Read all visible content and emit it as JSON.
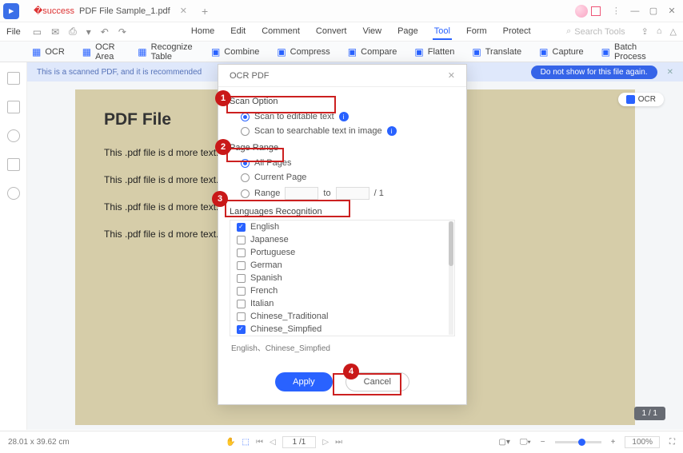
{
  "titlebar": {
    "tab_title": "PDF File Sample_1.pdf"
  },
  "menurow": {
    "file": "File",
    "items": [
      "Home",
      "Edit",
      "Comment",
      "Convert",
      "View",
      "Page",
      "Tool",
      "Form",
      "Protect"
    ],
    "active": "Tool",
    "search_placeholder": "Search Tools"
  },
  "toolbar": {
    "items": [
      "OCR",
      "OCR Area",
      "Recognize Table",
      "Combine",
      "Compress",
      "Compare",
      "Flatten",
      "Translate",
      "Capture",
      "Batch Process"
    ]
  },
  "banner": {
    "text": "This is a scanned PDF, and it is recommended",
    "pill": "Do not show for this file again."
  },
  "ocr_badge": "OCR",
  "document": {
    "heading": "PDF File",
    "p1": "This .pdf file is                                                                                                                   d more text.",
    "p2": "This .pdf file is                                                                                                                   d more text. More text. And more",
    "p3": "This .pdf file is                                                                                                                   d more text. More text. And more",
    "p4": "This .pdf file is                                                                                                                   d more text. More text. And more"
  },
  "modal": {
    "title": "OCR PDF",
    "scan_option_title": "Scan Option",
    "scan_editable": "Scan to editable text",
    "scan_searchable": "Scan to searchable text in image",
    "page_range_title": "Page Range",
    "all_pages": "All Pages",
    "current_page": "Current Page",
    "range": "Range",
    "to": "to",
    "range_total": "/ 1",
    "lang_title": "Languages Recognition",
    "langs": [
      "English",
      "Japanese",
      "Portuguese",
      "German",
      "Spanish",
      "French",
      "Italian",
      "Chinese_Traditional",
      "Chinese_Simpfied"
    ],
    "lang_checked": {
      "English": true,
      "Chinese_Simpfied": true
    },
    "selected_summary": "English、Chinese_Simpfied",
    "apply": "Apply",
    "cancel": "Cancel"
  },
  "page_indicator": "1 / 1",
  "bottom": {
    "coords": "28.01 x 39.62 cm",
    "page": "1 /1",
    "zoom": "100%"
  }
}
